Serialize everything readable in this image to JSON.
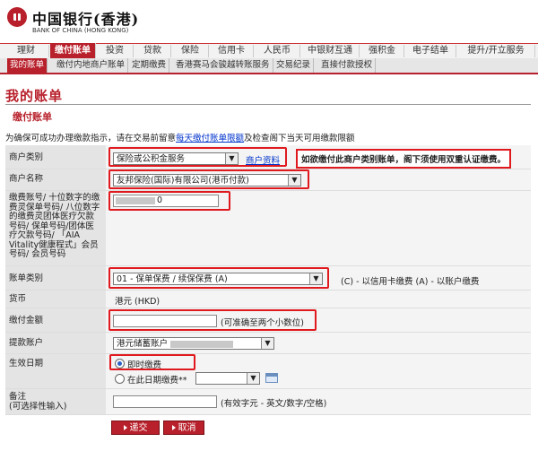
{
  "brand": {
    "cn": "中国银行(香港)",
    "en": "BANK OF CHINA",
    "en_sub": "(HONG KONG)",
    "color": "#b8202b"
  },
  "nav": [
    {
      "label": "理财",
      "active": false
    },
    {
      "label": "缴付账单",
      "active": true
    },
    {
      "label": "投资",
      "active": false
    },
    {
      "label": "贷款",
      "active": false
    },
    {
      "label": "保险",
      "active": false
    },
    {
      "label": "信用卡",
      "active": false
    },
    {
      "label": "人民币",
      "active": false
    },
    {
      "label": "中银财互通",
      "active": false
    },
    {
      "label": "强积金",
      "active": false
    },
    {
      "label": "电子结单",
      "active": false
    },
    {
      "label": "提升/开立服务",
      "active": false
    }
  ],
  "subnav": [
    {
      "label": "我的账单",
      "active": true
    },
    {
      "label": "缴付内地商户账单",
      "active": false
    },
    {
      "label": "定期缴费",
      "active": false
    },
    {
      "label": "香港赛马会骏越转账服务",
      "active": false
    },
    {
      "label": "交易纪录",
      "active": false
    },
    {
      "label": "直接付款授权",
      "active": false
    }
  ],
  "page_title": "我的账单",
  "section_title": "缴付账单",
  "notice": {
    "before": "为确保可成功办理缴款指示，请在交易前留意",
    "link": "每天缴付账单限额",
    "after": "及检查阁下当天可用缴款限额"
  },
  "form": {
    "merchant_type": {
      "label": "商户类别",
      "value": "保险或公积金服务",
      "link": "商户资料",
      "warning": "如欲缴付此商户类别账单，阁下须使用双重认证缴费。"
    },
    "merchant_name": {
      "label": "商户名称",
      "value": "友邦保险(国际)有限公司(港币付款)"
    },
    "account_no": {
      "label": "缴费账号/ 十位数字的缴费灵保单号码/ 八位数字的缴费灵团体医疗欠款号码/ 保单号码/团体医疗欠款号码/ 「AIA Vitality健康程式」会员号码/ 会员号码",
      "value_suffix": "0"
    },
    "account_type": {
      "label": "账单类别",
      "value": "01 - 保单保费 / 续保保费 (A)",
      "note": "(C) - 以信用卡缴费  (A) - 以账户缴费"
    },
    "currency": {
      "label": "货币",
      "value": "港元 (HKD)"
    },
    "amount": {
      "label": "缴付金额",
      "value": "",
      "hint": "(可准确至两个小数位)"
    },
    "debit_account": {
      "label": "提款账户",
      "value_prefix": "港元储蓄账户"
    },
    "effective_date": {
      "label": "生效日期",
      "opt_now": "即时缴费",
      "opt_later": "在此日期缴费**"
    },
    "remarks": {
      "label": "备注\n(可选择性输入)",
      "value": "",
      "hint": "(有效字元 - 英文/数字/空格)"
    }
  },
  "buttons": {
    "submit": "递交",
    "cancel": "取消"
  }
}
